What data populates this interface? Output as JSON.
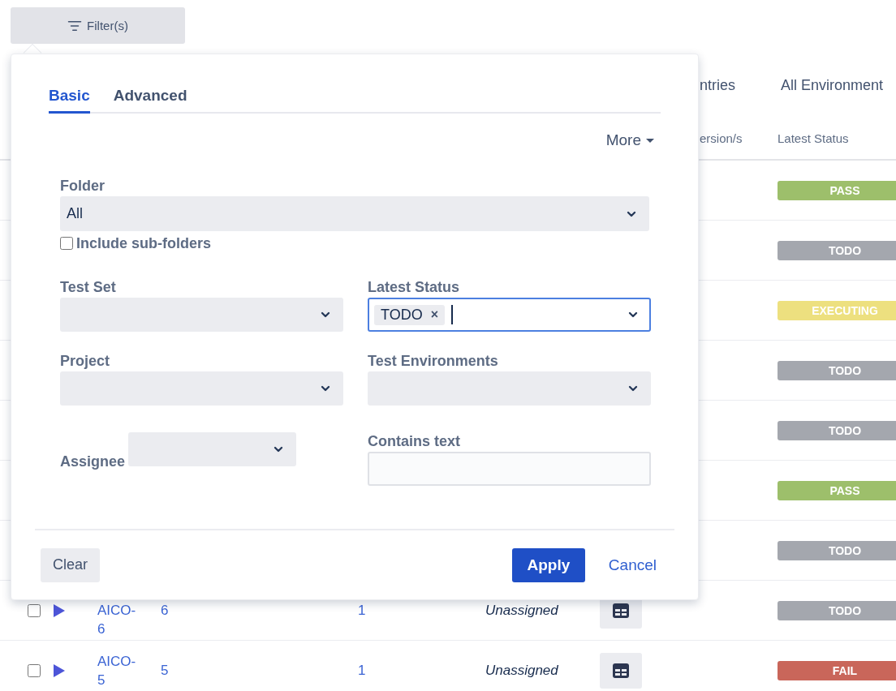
{
  "toolbar": {
    "filter_button": "Filter(s)"
  },
  "header_tabs": [
    "ntries",
    "All Environment"
  ],
  "table": {
    "columns": [
      "ersion/s",
      "Latest Status"
    ],
    "rows": [
      {
        "status": {
          "label": "PASS",
          "color": "#9dbf6b"
        }
      },
      {
        "status": {
          "label": "TODO",
          "color": "#a4a7ae"
        }
      },
      {
        "status": {
          "label": "EXECUTING",
          "color": "#ede07f"
        }
      },
      {
        "status": {
          "label": "TODO",
          "color": "#a4a7ae"
        }
      },
      {
        "status": {
          "label": "TODO",
          "color": "#a4a7ae"
        }
      },
      {
        "status": {
          "label": "PASS",
          "color": "#9dbf6b"
        }
      },
      {
        "status": {
          "label": "TODO",
          "color": "#a4a7ae"
        }
      },
      {
        "checked": false,
        "key": "AICO-6",
        "column_3": "6",
        "column_4": "1",
        "assignee": "Unassigned",
        "status": {
          "label": "TODO",
          "color": "#a4a7ae"
        }
      },
      {
        "checked": false,
        "key": "AICO-5",
        "column_3": "5",
        "column_4": "1",
        "assignee": "Unassigned",
        "status": {
          "label": "FAIL",
          "color": "#c9665a"
        }
      }
    ]
  },
  "filter_panel": {
    "tabs": [
      {
        "label": "Basic",
        "selected": true
      },
      {
        "label": "Advanced",
        "selected": false
      }
    ],
    "more": "More",
    "folder": {
      "label": "Folder",
      "value": "All"
    },
    "include_subfolders": {
      "label": "Include sub-folders",
      "checked": false
    },
    "field_rows": [
      [
        {
          "kind": "select",
          "label": "Test Set"
        },
        {
          "kind": "multiselect",
          "label": "Latest Status",
          "focused": true,
          "chips": [
            "TODO"
          ],
          "remove": "×"
        }
      ],
      [
        {
          "kind": "select",
          "label": "Project"
        },
        {
          "kind": "select",
          "label": "Test Environments"
        }
      ],
      [
        {
          "kind": "inline_select",
          "label": "Assignee"
        },
        {
          "kind": "text",
          "label": "Contains text"
        }
      ]
    ],
    "buttons": {
      "clear": "Clear",
      "apply": "Apply",
      "cancel": "Cancel"
    }
  }
}
